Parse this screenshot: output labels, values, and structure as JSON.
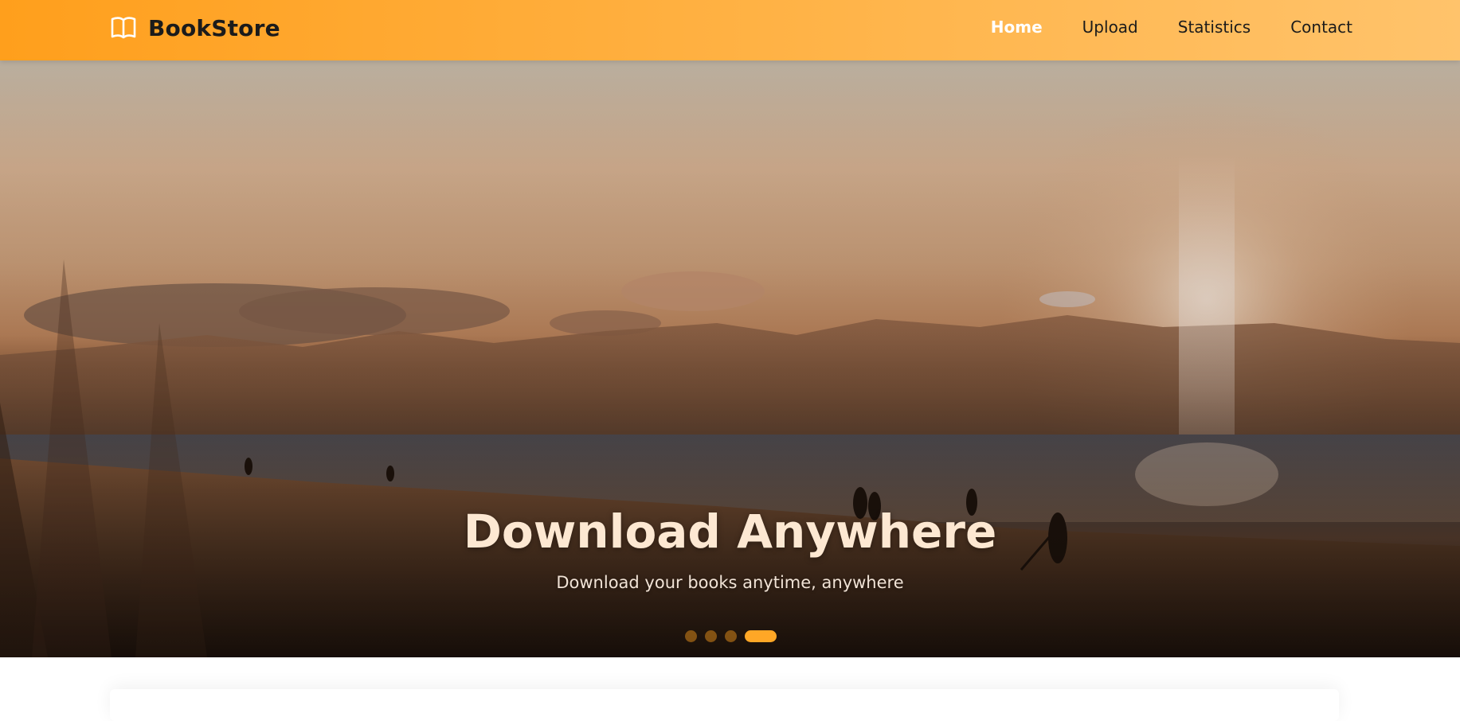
{
  "header": {
    "brand_name": "BookStore",
    "brand_icon": "open-book-icon",
    "nav": [
      {
        "label": "Home",
        "active": true
      },
      {
        "label": "Upload",
        "active": false
      },
      {
        "label": "Statistics",
        "active": false
      },
      {
        "label": "Contact",
        "active": false
      }
    ]
  },
  "hero": {
    "title": "Download Anywhere",
    "subtitle": "Download your books anytime, anywhere",
    "slide_count": 4,
    "active_slide": 4
  },
  "colors": {
    "accent": "#ffa726",
    "header_start": "#ff9f1c",
    "header_end": "#ffc36b"
  }
}
